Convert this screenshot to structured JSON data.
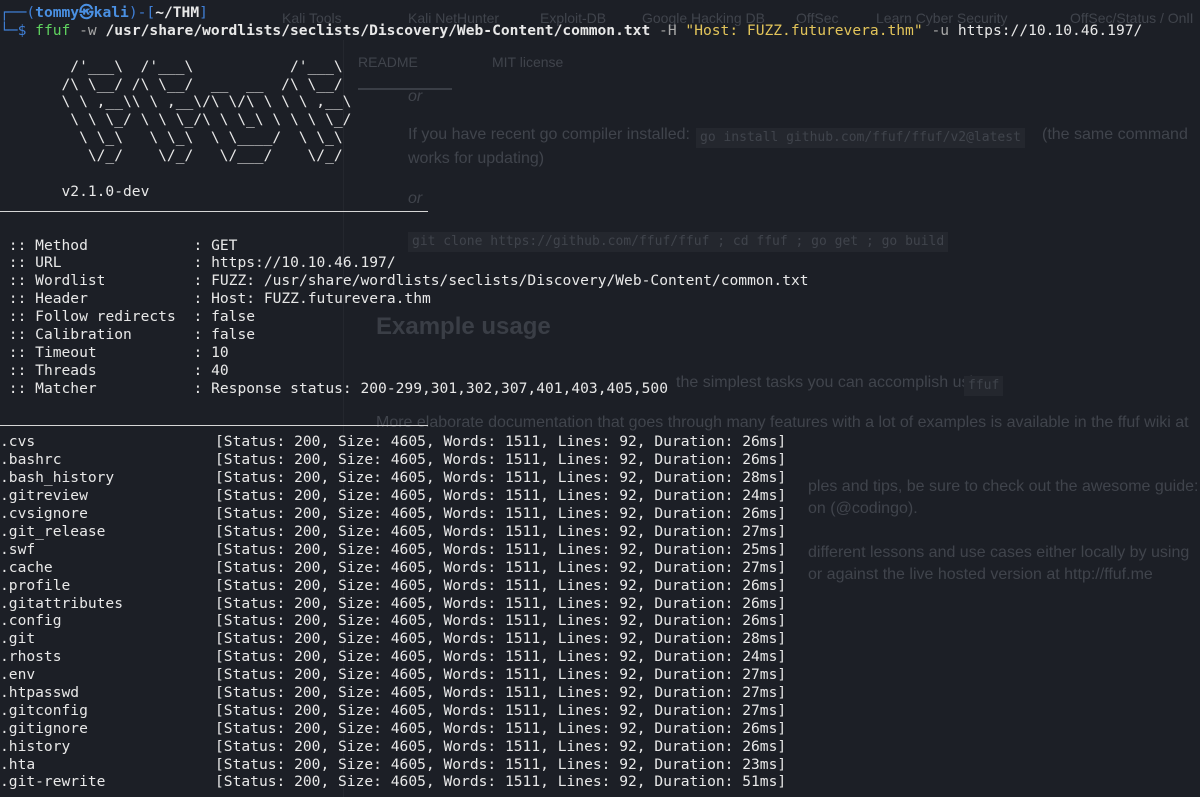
{
  "backdrop": {
    "bookmarks": [
      "Kali Tools",
      "Kali NetHunter",
      "Exploit-DB",
      "Google Hacking DB",
      "OffSec",
      "Learn Cyber Security",
      "OffSec/Status / OnlI"
    ],
    "tabs": [
      "README",
      "MIT license"
    ],
    "texts": [
      "or",
      "If you have recent go compiler installed:",
      "go install github.com/ffuf/ffuf/v2@latest",
      "(the same command",
      "works for updating)",
      "or",
      "git clone https://github.com/ffuf/ffuf ; cd ffuf ; go get ; go build",
      "Example usage",
      "the simplest tasks you can accomplish using",
      "ffuf",
      "More elaborate documentation that goes through many features with a lot of examples is available in the ffuf wiki at",
      "ples and tips, be sure to check out the awesome guide:",
      "on (@codingo).",
      "different lessons and use cases either locally by using",
      "or against the live hosted version at http://ffuf.me"
    ]
  },
  "prompt": {
    "frame_top": "┌──(",
    "user": "tommy㉿kali",
    "frame_mid": ")-[",
    "cwd": "~/THM",
    "frame_end": "]",
    "frame_bottom": "└─$ ",
    "cmd": "ffuf",
    "opt_w": "-w",
    "wordlist": "/usr/share/wordlists/seclists/Discovery/Web-Content/common.txt",
    "opt_H": "-H",
    "header": "\"Host: FUZZ.futurevera.thm\"",
    "opt_u": "-u",
    "url": "https://10.10.46.197/"
  },
  "banner": [
    "        /'___\\  /'___\\           /'___\\       ",
    "       /\\ \\__/ /\\ \\__/  __  __  /\\ \\__/       ",
    "       \\ \\ ,__\\\\ \\ ,__\\/\\ \\/\\ \\ \\ \\ ,__\\      ",
    "        \\ \\ \\_/ \\ \\ \\_/\\ \\ \\_\\ \\ \\ \\ \\_/      ",
    "         \\ \\_\\   \\ \\_\\  \\ \\____/  \\ \\_\\       ",
    "          \\/_/    \\/_/   \\/___/    \\/_/       "
  ],
  "version": "       v2.1.0-dev",
  "config": [
    {
      "key": "Method",
      "value": "GET"
    },
    {
      "key": "URL",
      "value": "https://10.10.46.197/"
    },
    {
      "key": "Wordlist",
      "value": "FUZZ: /usr/share/wordlists/seclists/Discovery/Web-Content/common.txt"
    },
    {
      "key": "Header",
      "value": "Host: FUZZ.futurevera.thm"
    },
    {
      "key": "Follow redirects",
      "value": "false"
    },
    {
      "key": "Calibration",
      "value": "false"
    },
    {
      "key": "Timeout",
      "value": "10"
    },
    {
      "key": "Threads",
      "value": "40"
    },
    {
      "key": "Matcher",
      "value": "Response status: 200-299,301,302,307,401,403,405,500"
    }
  ],
  "results": [
    {
      "name": ".cvs",
      "status": "200",
      "size": "4605",
      "words": "1511",
      "lines": "92",
      "duration": "26ms"
    },
    {
      "name": ".bashrc",
      "status": "200",
      "size": "4605",
      "words": "1511",
      "lines": "92",
      "duration": "26ms"
    },
    {
      "name": ".bash_history",
      "status": "200",
      "size": "4605",
      "words": "1511",
      "lines": "92",
      "duration": "28ms"
    },
    {
      "name": ".gitreview",
      "status": "200",
      "size": "4605",
      "words": "1511",
      "lines": "92",
      "duration": "24ms"
    },
    {
      "name": ".cvsignore",
      "status": "200",
      "size": "4605",
      "words": "1511",
      "lines": "92",
      "duration": "26ms"
    },
    {
      "name": ".git_release",
      "status": "200",
      "size": "4605",
      "words": "1511",
      "lines": "92",
      "duration": "27ms"
    },
    {
      "name": ".swf",
      "status": "200",
      "size": "4605",
      "words": "1511",
      "lines": "92",
      "duration": "25ms"
    },
    {
      "name": ".cache",
      "status": "200",
      "size": "4605",
      "words": "1511",
      "lines": "92",
      "duration": "27ms"
    },
    {
      "name": ".profile",
      "status": "200",
      "size": "4605",
      "words": "1511",
      "lines": "92",
      "duration": "26ms"
    },
    {
      "name": ".gitattributes",
      "status": "200",
      "size": "4605",
      "words": "1511",
      "lines": "92",
      "duration": "26ms"
    },
    {
      "name": ".config",
      "status": "200",
      "size": "4605",
      "words": "1511",
      "lines": "92",
      "duration": "26ms"
    },
    {
      "name": ".git",
      "status": "200",
      "size": "4605",
      "words": "1511",
      "lines": "92",
      "duration": "28ms"
    },
    {
      "name": ".rhosts",
      "status": "200",
      "size": "4605",
      "words": "1511",
      "lines": "92",
      "duration": "24ms"
    },
    {
      "name": ".env",
      "status": "200",
      "size": "4605",
      "words": "1511",
      "lines": "92",
      "duration": "27ms"
    },
    {
      "name": ".htpasswd",
      "status": "200",
      "size": "4605",
      "words": "1511",
      "lines": "92",
      "duration": "27ms"
    },
    {
      "name": ".gitconfig",
      "status": "200",
      "size": "4605",
      "words": "1511",
      "lines": "92",
      "duration": "27ms"
    },
    {
      "name": ".gitignore",
      "status": "200",
      "size": "4605",
      "words": "1511",
      "lines": "92",
      "duration": "26ms"
    },
    {
      "name": ".history",
      "status": "200",
      "size": "4605",
      "words": "1511",
      "lines": "92",
      "duration": "26ms"
    },
    {
      "name": ".hta",
      "status": "200",
      "size": "4605",
      "words": "1511",
      "lines": "92",
      "duration": "23ms"
    },
    {
      "name": ".git-rewrite",
      "status": "200",
      "size": "4605",
      "words": "1511",
      "lines": "92",
      "duration": "51ms"
    }
  ],
  "colors": {
    "background": "#1c1f26",
    "prompt_frame": "#3f7fd6",
    "command": "#5fd35f",
    "string": "#e2c45a",
    "text": "#e8e8e8"
  }
}
